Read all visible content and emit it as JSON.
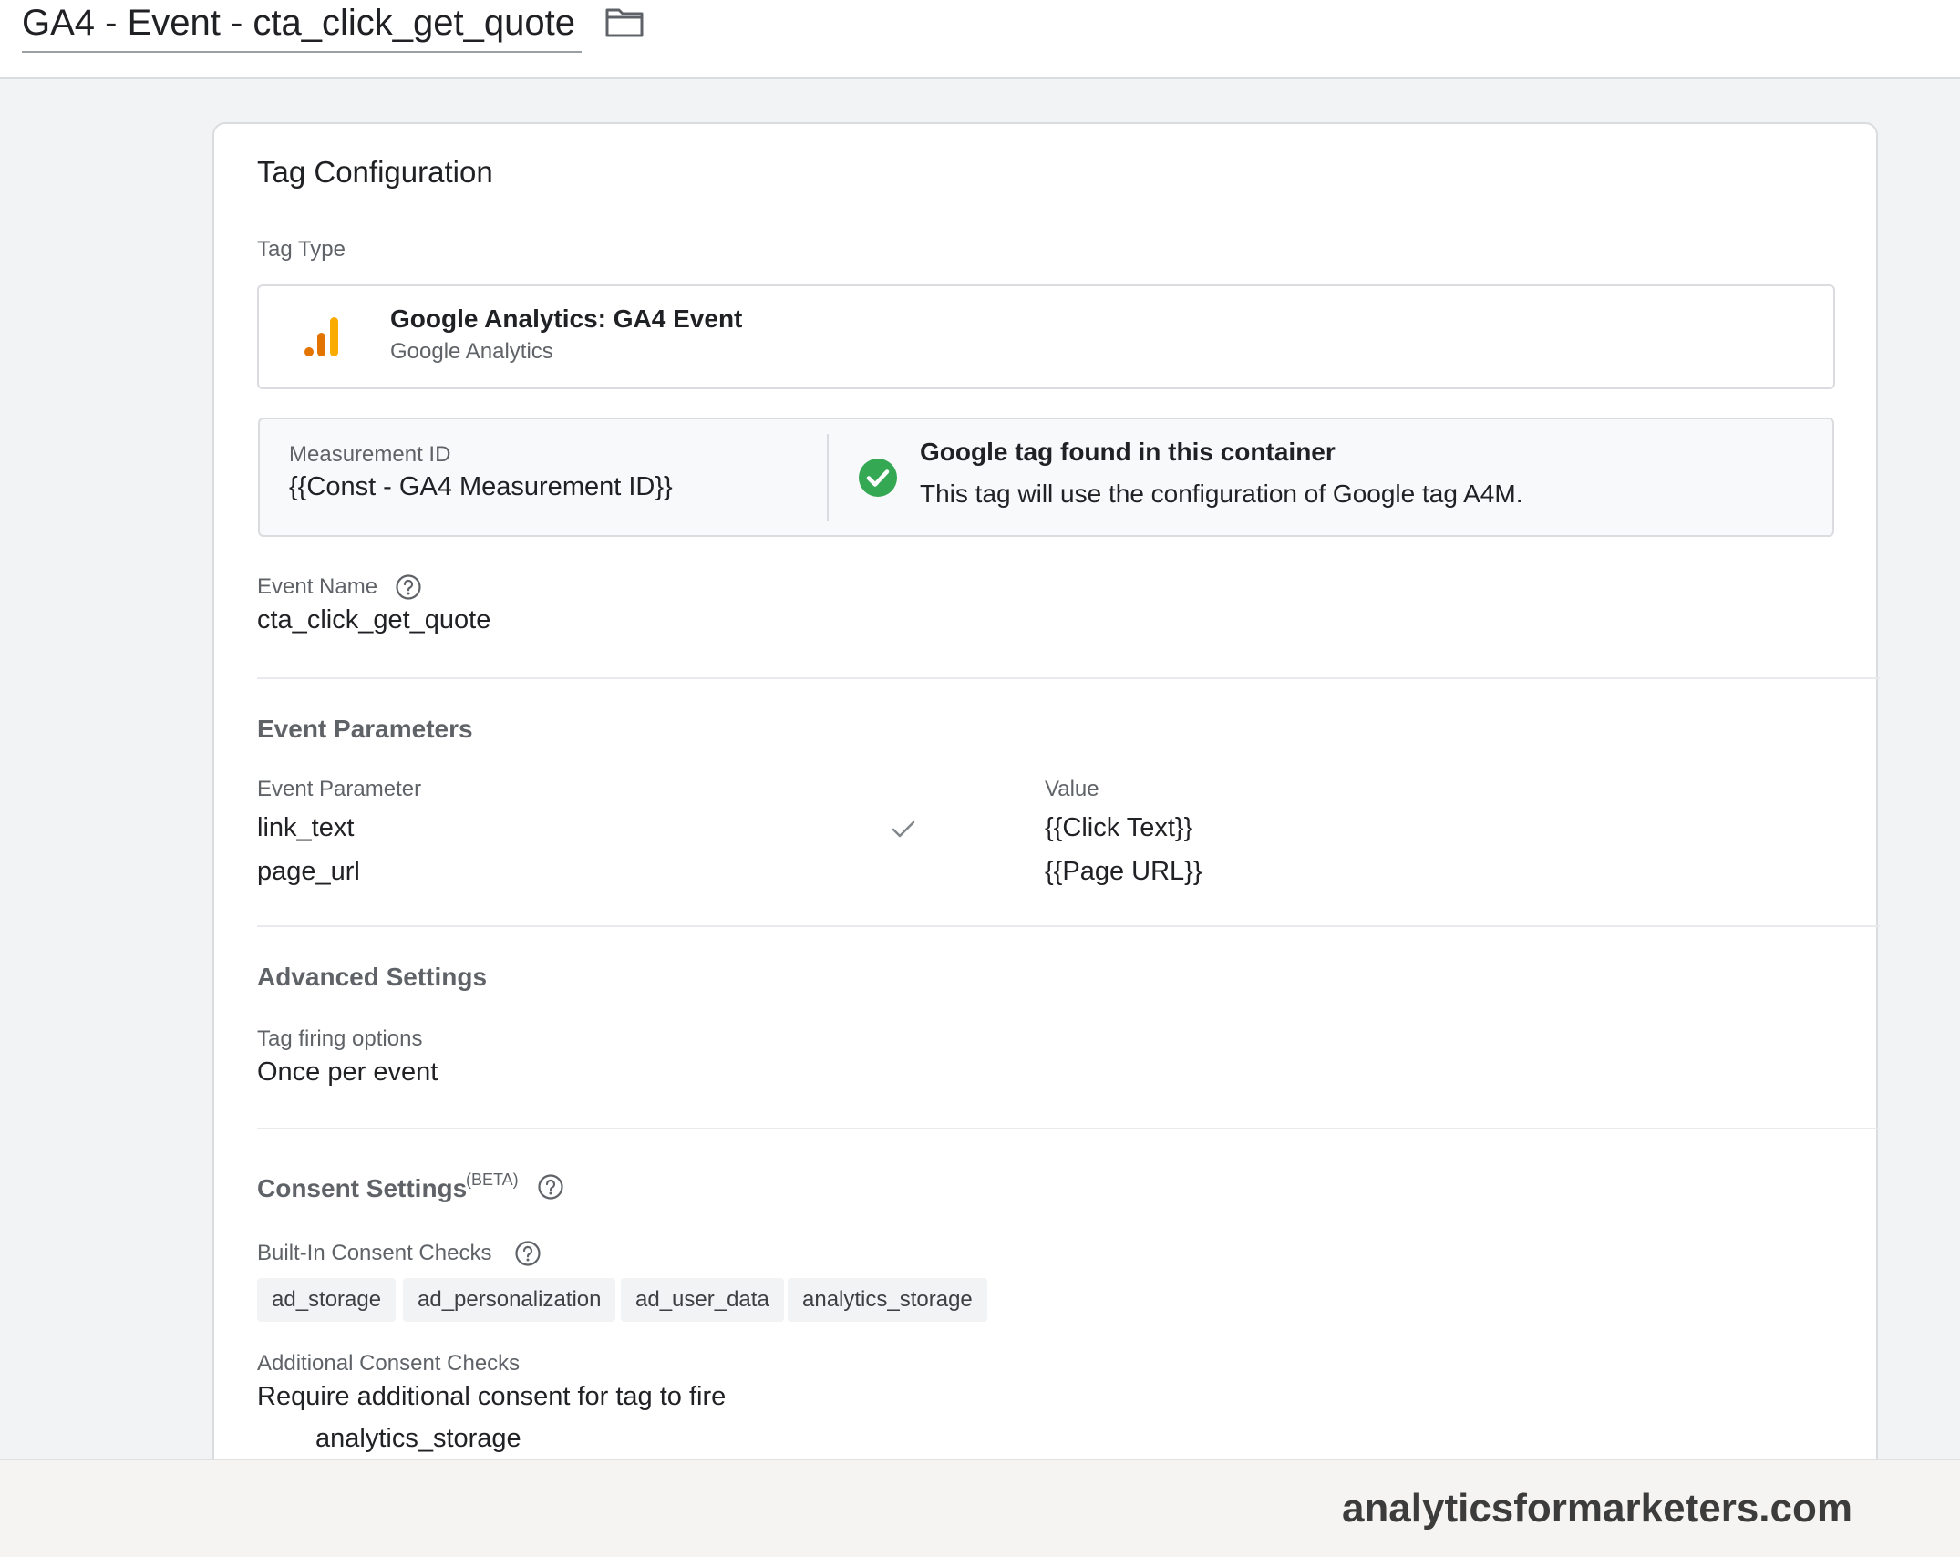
{
  "header": {
    "tag_title": "GA4 - Event - cta_click_get_quote"
  },
  "tag_configuration": {
    "title": "Tag Configuration",
    "tag_type_label": "Tag Type",
    "tag_type_name": "Google Analytics: GA4 Event",
    "tag_type_vendor": "Google Analytics",
    "measurement_id_label": "Measurement ID",
    "measurement_id_value": "{{Const - GA4 Measurement ID}}",
    "google_tag_status_title": "Google tag found in this container",
    "google_tag_status_text": "This tag will use the configuration of Google tag A4M.",
    "event_name_label": "Event Name",
    "event_name_value": "cta_click_get_quote"
  },
  "event_parameters": {
    "title": "Event Parameters",
    "columns": {
      "parameter": "Event Parameter",
      "value": "Value"
    },
    "rows": [
      {
        "parameter": "link_text",
        "value": "{{Click Text}}"
      },
      {
        "parameter": "page_url",
        "value": "{{Page URL}}"
      }
    ]
  },
  "advanced_settings": {
    "title": "Advanced Settings",
    "firing_label": "Tag firing options",
    "firing_value": "Once per event"
  },
  "consent_settings": {
    "title": "Consent Settings",
    "beta": "(BETA)",
    "builtin_label": "Built-In Consent Checks",
    "builtin_checks": [
      "ad_storage",
      "ad_personalization",
      "ad_user_data",
      "analytics_storage"
    ],
    "additional_label": "Additional Consent Checks",
    "additional_value": "Require additional consent for tag to fire",
    "additional_item": "analytics_storage"
  },
  "footer": {
    "brand": "analyticsformarketers.com"
  },
  "icons": {
    "folder": "folder-icon",
    "ga": "google-analytics-icon",
    "check": "check-circle-icon",
    "help": "help-icon"
  },
  "colors": {
    "success": "#34a853",
    "ga_orange_dark": "#e37400",
    "ga_orange_light": "#f9ab00"
  }
}
